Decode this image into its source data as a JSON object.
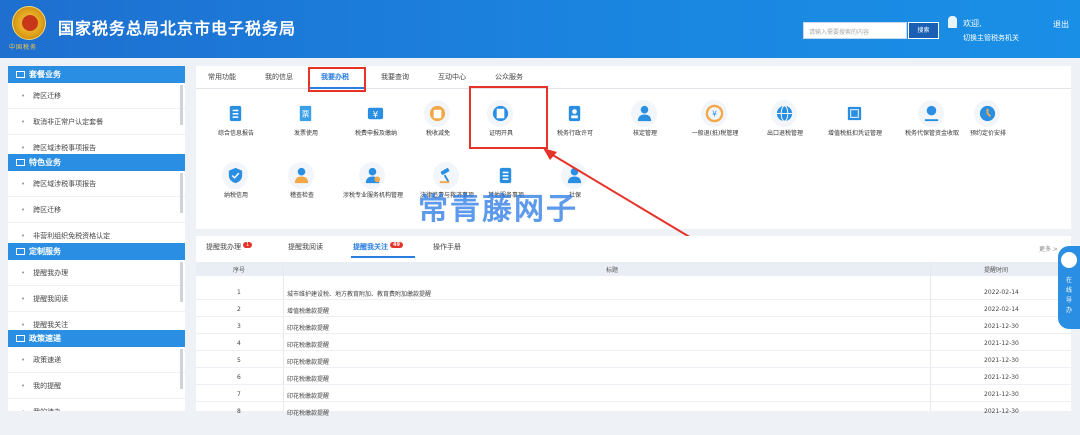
{
  "header": {
    "emblem_text": "中国税务",
    "title": "国家税务总局北京市电子税务局",
    "search_placeholder": "请输入需要搜索的内容",
    "search_button": "搜索",
    "welcome": "欢迎,",
    "switch_link": "切换主管税务机关",
    "logout": "退出"
  },
  "sidebar": {
    "sections": [
      {
        "title": "套餐业务",
        "items": [
          "跨区迁移",
          "取消非正常户认定套餐",
          "跨区域涉税事项报告"
        ]
      },
      {
        "title": "特色业务",
        "items": [
          "跨区域涉税事项报告",
          "跨区迁移",
          "非营利组织免税资格认定"
        ]
      },
      {
        "title": "定制服务",
        "items": [
          "提醒我办理",
          "提醒我阅读",
          "提醒我关注"
        ]
      },
      {
        "title": "政策速递",
        "items": [
          "政策速递",
          "我的提醒",
          "我的待办"
        ]
      }
    ]
  },
  "main": {
    "tabs": [
      "常用功能",
      "我的信息",
      "我要办税",
      "我要查询",
      "互动中心",
      "公众服务"
    ],
    "active_tab": 2,
    "tiles": [
      "综合信息报告",
      "发票使用",
      "税费申报及缴纳",
      "税收减免",
      "证明开具",
      "税务行政许可",
      "核定管理",
      "一般退(抵)税管理",
      "出口退税管理",
      "增值税抵扣凭证管理",
      "税务代保管资金收取",
      "预约定价安排",
      "纳税信用",
      "稽查检查",
      "涉税专业服务机构管理",
      "法律追责与救济事项",
      "其他服务事项",
      "社保"
    ]
  },
  "reminders": {
    "tabs": [
      {
        "label": "提醒我办理",
        "badge": "1"
      },
      {
        "label": "提醒我阅读",
        "badge": ""
      },
      {
        "label": "提醒我关注",
        "badge": "49"
      },
      {
        "label": "操作手册",
        "badge": ""
      }
    ],
    "active_tab": 2,
    "more": "更多 >",
    "columns": [
      "序号",
      "标题",
      "提醒时间"
    ],
    "rows": [
      [
        "1",
        "城市维护建设税、地方教育附加、教育费附加缴款提醒",
        "2022-02-14"
      ],
      [
        "2",
        "增值税缴款提醒",
        "2022-02-14"
      ],
      [
        "3",
        "印花税缴款提醒",
        "2021-12-30"
      ],
      [
        "4",
        "印花税缴款提醒",
        "2021-12-30"
      ],
      [
        "5",
        "印花税缴款提醒",
        "2021-12-30"
      ],
      [
        "6",
        "印花税缴款提醒",
        "2021-12-30"
      ],
      [
        "7",
        "印花税缴款提醒",
        "2021-12-30"
      ],
      [
        "8",
        "印花税缴款提醒",
        "2021-12-30"
      ]
    ]
  },
  "watermark": "常青藤网子",
  "float_button": "在线导办",
  "colors": {
    "primary": "#2a8fe2",
    "header": "#1e6fd0",
    "highlight": "#e5332a"
  }
}
